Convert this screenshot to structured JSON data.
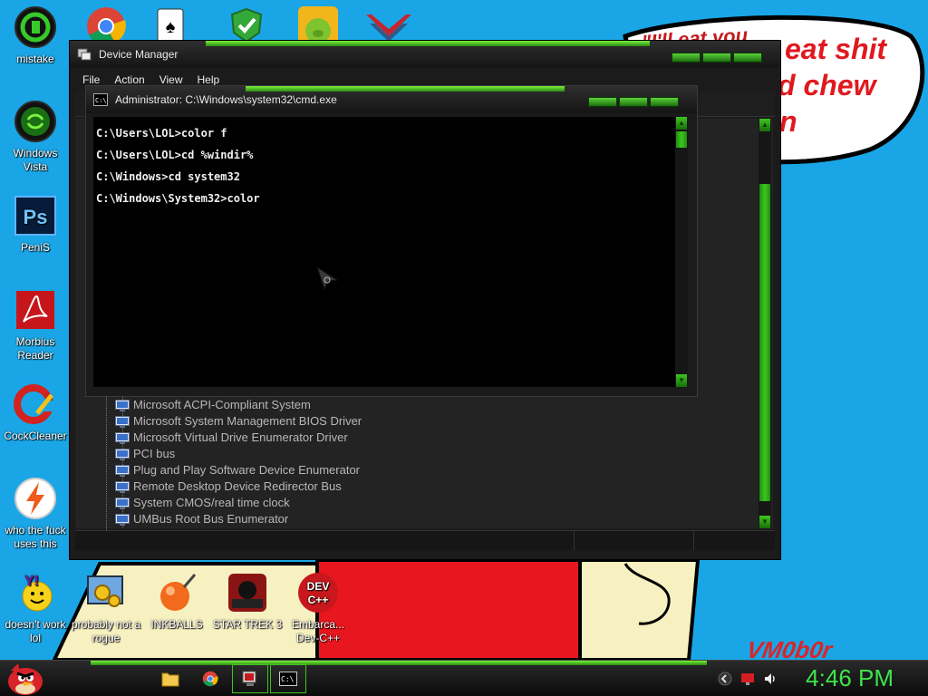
{
  "desktop": {
    "icons": [
      {
        "label": "mistake",
        "icon": "green-ring-icon"
      },
      {
        "label": "Windows Vista",
        "icon": "recycle-bin-icon"
      },
      {
        "label": "PeniS",
        "icon": "photoshop-icon"
      },
      {
        "label": "Morbius Reader",
        "icon": "acrobat-icon"
      },
      {
        "label": "CockCleaner",
        "icon": "ccleaner-icon"
      },
      {
        "label": "who the fuck uses this",
        "icon": "winamp-bolt-icon"
      },
      {
        "label": "doesn't work lol",
        "icon": "yahoo-messenger-icon"
      },
      {
        "label": "probably not a rogue",
        "icon": "control-panel-icon"
      },
      {
        "label": "INKBALLS",
        "icon": "inkball-icon"
      },
      {
        "label": "STAR TREK 3",
        "icon": "star-wars-icon"
      },
      {
        "label": "Embarca... Dev-C++",
        "icon": "devcpp-icon"
      }
    ],
    "top_shortcuts": [
      "chrome-icon",
      "solitaire-icon",
      "security-shield-icon",
      "bad-piggies-icon",
      "emblem-icon"
    ]
  },
  "wallpaper": {
    "bubble_text_line1": "eat shit",
    "bubble_text_line2": "d chew",
    "bubble_text_line3": "n",
    "bubble_text_scribble": "\"I'll eat you",
    "signature": "VM0b0r"
  },
  "device_manager": {
    "title": "Device Manager",
    "menu": [
      "File",
      "Action",
      "View",
      "Help"
    ],
    "devices": [
      "Microsoft ACPI-Compliant System",
      "Microsoft System Management BIOS Driver",
      "Microsoft Virtual Drive Enumerator Driver",
      "PCI bus",
      "Plug and Play Software Device Enumerator",
      "Remote Desktop Device Redirector Bus",
      "System CMOS/real time clock",
      "UMBus Root Bus Enumerator"
    ]
  },
  "cmd": {
    "title": "Administrator: C:\\Windows\\system32\\cmd.exe",
    "lines": [
      "C:\\Users\\LOL>color f",
      "C:\\Users\\LOL>cd %windir%",
      "C:\\Windows>cd system32",
      "C:\\Windows\\System32>color"
    ]
  },
  "taskbar": {
    "start_icon": "angry-bird-icon",
    "pinned": [
      "explorer-folder-icon",
      "chrome-icon",
      "device-manager-icon",
      "cmd-icon"
    ],
    "clock": "4:46 PM",
    "tray": [
      "notification-chevron-icon",
      "action-center-flag-icon",
      "volume-icon"
    ]
  },
  "colors": {
    "desktop_bg": "#1aa6e6",
    "accent_green": "#3ec61f",
    "clock_green": "#3de44a",
    "window_bg": "#1b1b1b"
  }
}
